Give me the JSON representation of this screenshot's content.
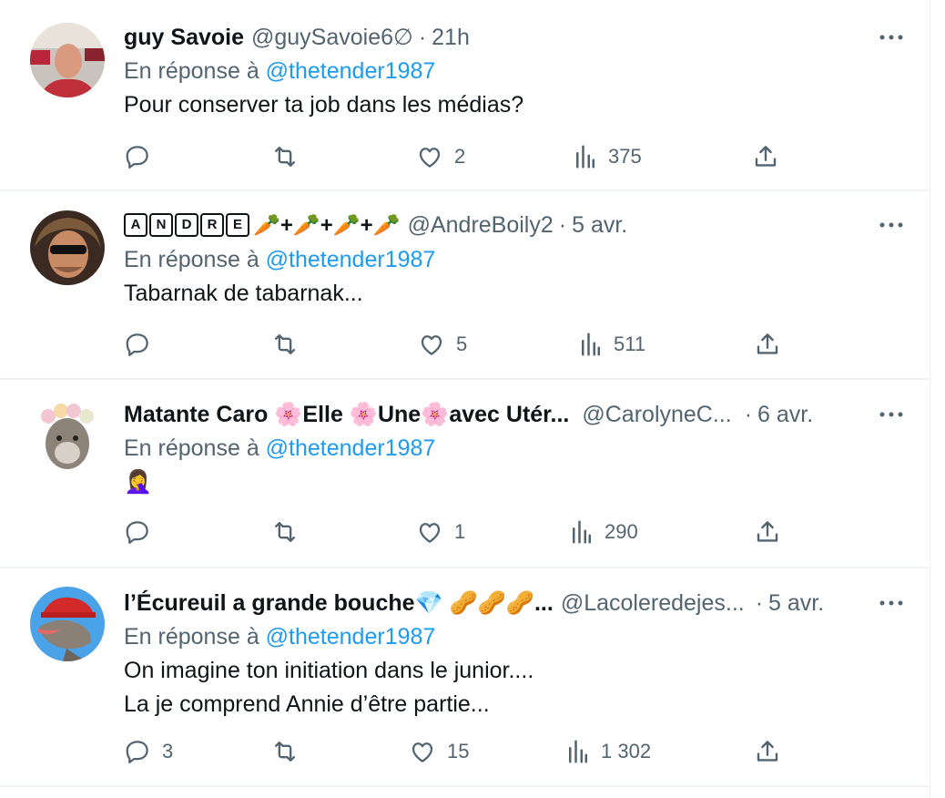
{
  "tweets": [
    {
      "name": "guy Savoie",
      "handle": "@guySavoie6∅",
      "time": "21h",
      "reply_prefix": "En réponse à",
      "reply_mention": "@thetender1987",
      "text_lines": [
        "Pour conserver ta job dans les médias?"
      ],
      "stats": {
        "reply": "",
        "retweet": "",
        "like": "2",
        "views": "375"
      }
    },
    {
      "name_letters": [
        "A",
        "N",
        "D",
        "R",
        "E"
      ],
      "name_suffix": "🥕+🥕+🥕+🥕",
      "handle": "@AndreBoily2",
      "time": "5 avr.",
      "reply_prefix": "En réponse à",
      "reply_mention": "@thetender1987",
      "text_lines": [
        "Tabarnak de tabarnak..."
      ],
      "stats": {
        "reply": "",
        "retweet": "",
        "like": "5",
        "views": "511"
      }
    },
    {
      "name": "Matante Caro 🌸Elle 🌸Une🌸avec Utér...",
      "handle": "@CarolyneC...",
      "time": "6 avr.",
      "reply_prefix": "En réponse à",
      "reply_mention": "@thetender1987",
      "text_lines": [
        "🤦‍♀️"
      ],
      "stats": {
        "reply": "",
        "retweet": "",
        "like": "1",
        "views": "290"
      }
    },
    {
      "name": "l’Écureuil a grande bouche💎 🥜🥜🥜...",
      "handle": "@Lacoleredejes...",
      "time": "5 avr.",
      "reply_prefix": "En réponse à",
      "reply_mention": "@thetender1987",
      "text_lines": [
        "On imagine ton initiation dans le junior....",
        "La je comprend Annie d’être partie..."
      ],
      "stats": {
        "reply": "3",
        "retweet": "",
        "like": "15",
        "views": "1 302"
      }
    }
  ],
  "separator": "·",
  "colors": {
    "text": "#0f1419",
    "secondary": "#536471",
    "link": "#1d9bf0",
    "border": "#eff3f4"
  }
}
